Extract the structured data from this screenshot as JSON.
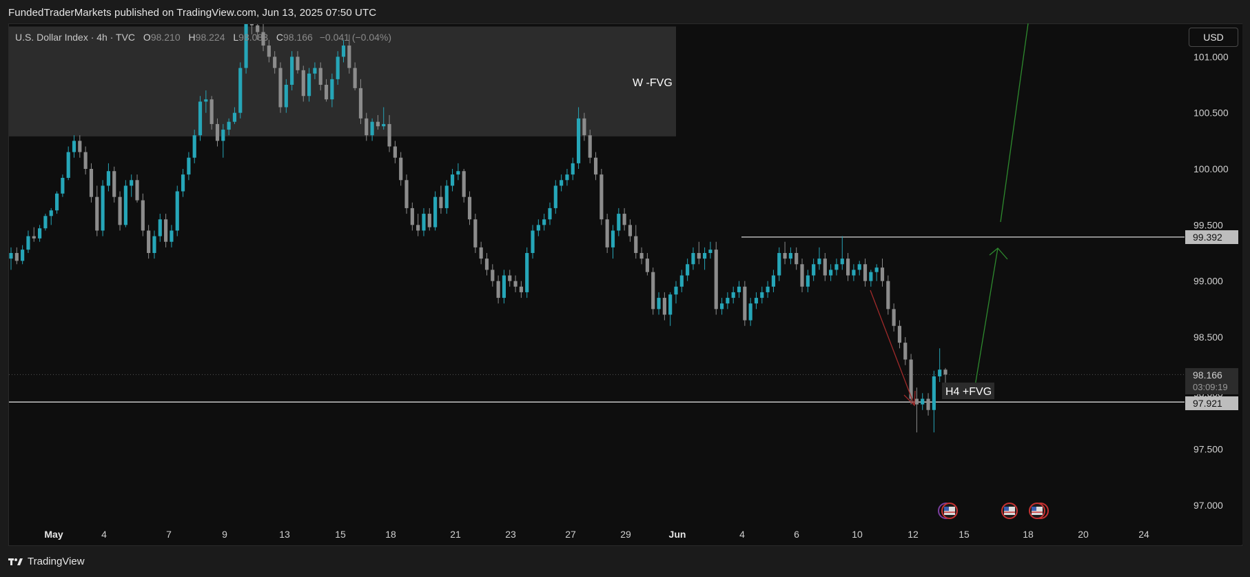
{
  "header": {
    "publisher": "FundedTraderMarkets published on TradingView.com, Jun 13, 2025 07:50 UTC"
  },
  "legend": {
    "symbol": "U.S. Dollar Index · 4h · TVC",
    "o_label": "O",
    "o_value": "98.210",
    "h_label": "H",
    "h_value": "98.224",
    "l_label": "L",
    "l_value": "98.083",
    "c_label": "C",
    "c_value": "98.166",
    "change": "−0.041 (−0.04%)"
  },
  "currency_button": "USD",
  "footer": {
    "brand": "TradingView"
  },
  "annotations": {
    "w_fvg": "W -FVG",
    "h4_fvg": "H4 +FVG"
  },
  "price_tags": {
    "resistance": "99.392",
    "last_price": "98.166",
    "countdown": "03:09:19",
    "support": "97.921"
  },
  "colors": {
    "up": "#26a6b8",
    "down": "#8c8c8c",
    "zone": "#2c2c2c",
    "arrow_up": "#2e8b2e",
    "arrow_down": "#a02a2a",
    "background": "#0e0e0e"
  },
  "chart_data": {
    "type": "candlestick",
    "yaxis": {
      "ticks": [
        "101.000",
        "100.500",
        "100.000",
        "99.500",
        "99.000",
        "98.500",
        "98.000",
        "97.500",
        "97.000"
      ],
      "range": [
        96.7,
        101.35
      ]
    },
    "xaxis": {
      "ticks": [
        "May",
        "4",
        "7",
        "9",
        "13",
        "15",
        "18",
        "21",
        "23",
        "27",
        "29",
        "Jun",
        "4",
        "6",
        "10",
        "12",
        "15",
        "18",
        "20",
        "24"
      ]
    },
    "zones": [
      {
        "label": "W -FVG",
        "from": 100.29,
        "to": 101.27
      }
    ],
    "levels": [
      {
        "value": 99.392,
        "label": "99.392"
      },
      {
        "value": 97.921,
        "label": "97.921"
      }
    ],
    "last": 98.166,
    "candles": [
      [
        99.2,
        99.3,
        99.1,
        99.25
      ],
      [
        99.25,
        99.3,
        99.15,
        99.18
      ],
      [
        99.18,
        99.32,
        99.15,
        99.28
      ],
      [
        99.28,
        99.45,
        99.25,
        99.4
      ],
      [
        99.4,
        99.48,
        99.35,
        99.38
      ],
      [
        99.38,
        99.5,
        99.35,
        99.47
      ],
      [
        99.47,
        99.6,
        99.45,
        99.58
      ],
      [
        99.58,
        99.65,
        99.5,
        99.63
      ],
      [
        99.63,
        99.8,
        99.6,
        99.78
      ],
      [
        99.78,
        99.95,
        99.75,
        99.92
      ],
      [
        99.92,
        100.2,
        99.9,
        100.15
      ],
      [
        100.15,
        100.3,
        100.1,
        100.25
      ],
      [
        100.25,
        100.3,
        100.1,
        100.15
      ],
      [
        100.15,
        100.2,
        99.95,
        100.0
      ],
      [
        100.0,
        100.05,
        99.7,
        99.75
      ],
      [
        99.75,
        99.85,
        99.4,
        99.45
      ],
      [
        99.45,
        99.9,
        99.4,
        99.85
      ],
      [
        99.85,
        100.05,
        99.8,
        99.98
      ],
      [
        99.98,
        100.02,
        99.7,
        99.75
      ],
      [
        99.75,
        99.8,
        99.45,
        99.5
      ],
      [
        99.5,
        99.9,
        99.48,
        99.85
      ],
      [
        99.85,
        99.95,
        99.75,
        99.9
      ],
      [
        99.9,
        99.95,
        99.7,
        99.72
      ],
      [
        99.72,
        99.78,
        99.4,
        99.45
      ],
      [
        99.45,
        99.5,
        99.2,
        99.25
      ],
      [
        99.25,
        99.45,
        99.2,
        99.4
      ],
      [
        99.4,
        99.6,
        99.35,
        99.55
      ],
      [
        99.55,
        99.6,
        99.3,
        99.35
      ],
      [
        99.35,
        99.5,
        99.3,
        99.45
      ],
      [
        99.45,
        99.85,
        99.4,
        99.8
      ],
      [
        99.8,
        100.0,
        99.75,
        99.95
      ],
      [
        99.95,
        100.15,
        99.9,
        100.1
      ],
      [
        100.1,
        100.35,
        100.05,
        100.3
      ],
      [
        100.3,
        100.65,
        100.25,
        100.6
      ],
      [
        100.6,
        100.7,
        100.5,
        100.62
      ],
      [
        100.62,
        100.65,
        100.35,
        100.4
      ],
      [
        100.4,
        100.45,
        100.2,
        100.25
      ],
      [
        100.25,
        100.4,
        100.1,
        100.35
      ],
      [
        100.35,
        100.45,
        100.3,
        100.42
      ],
      [
        100.42,
        100.55,
        100.4,
        100.5
      ],
      [
        100.5,
        100.95,
        100.45,
        100.9
      ],
      [
        100.9,
        101.4,
        100.85,
        101.3
      ],
      [
        101.3,
        101.35,
        101.2,
        101.28
      ],
      [
        101.28,
        101.32,
        101.15,
        101.22
      ],
      [
        101.22,
        101.3,
        101.05,
        101.1
      ],
      [
        101.1,
        101.15,
        100.95,
        101.0
      ],
      [
        101.0,
        101.05,
        100.85,
        100.9
      ],
      [
        100.9,
        100.95,
        100.5,
        100.55
      ],
      [
        100.55,
        100.8,
        100.5,
        100.75
      ],
      [
        100.75,
        101.05,
        100.7,
        101.0
      ],
      [
        101.0,
        101.05,
        100.85,
        100.88
      ],
      [
        100.88,
        100.92,
        100.6,
        100.65
      ],
      [
        100.65,
        100.9,
        100.6,
        100.85
      ],
      [
        100.85,
        100.95,
        100.8,
        100.9
      ],
      [
        100.9,
        100.95,
        100.7,
        100.75
      ],
      [
        100.75,
        100.8,
        100.6,
        100.62
      ],
      [
        100.62,
        100.85,
        100.55,
        100.8
      ],
      [
        100.8,
        101.05,
        100.75,
        101.0
      ],
      [
        101.0,
        101.15,
        100.95,
        101.1
      ],
      [
        101.1,
        101.2,
        100.85,
        100.9
      ],
      [
        100.9,
        100.95,
        100.7,
        100.72
      ],
      [
        100.72,
        100.8,
        100.4,
        100.45
      ],
      [
        100.45,
        100.5,
        100.25,
        100.3
      ],
      [
        100.3,
        100.45,
        100.25,
        100.42
      ],
      [
        100.42,
        100.48,
        100.35,
        100.38
      ],
      [
        100.38,
        100.55,
        100.35,
        100.4
      ],
      [
        100.4,
        100.48,
        100.15,
        100.2
      ],
      [
        100.2,
        100.25,
        100.05,
        100.1
      ],
      [
        100.1,
        100.15,
        99.85,
        99.9
      ],
      [
        99.9,
        99.95,
        99.6,
        99.65
      ],
      [
        99.65,
        99.7,
        99.45,
        99.5
      ],
      [
        99.5,
        99.6,
        99.4,
        99.45
      ],
      [
        99.45,
        99.65,
        99.4,
        99.6
      ],
      [
        99.6,
        99.65,
        99.45,
        99.48
      ],
      [
        99.48,
        99.8,
        99.45,
        99.75
      ],
      [
        99.75,
        99.85,
        99.6,
        99.65
      ],
      [
        99.65,
        99.9,
        99.6,
        99.85
      ],
      [
        99.85,
        100.0,
        99.8,
        99.95
      ],
      [
        99.95,
        100.05,
        99.9,
        99.98
      ],
      [
        99.98,
        100.0,
        99.7,
        99.75
      ],
      [
        99.75,
        99.8,
        99.5,
        99.55
      ],
      [
        99.55,
        99.6,
        99.25,
        99.3
      ],
      [
        99.3,
        99.35,
        99.15,
        99.2
      ],
      [
        99.2,
        99.25,
        99.05,
        99.1
      ],
      [
        99.1,
        99.15,
        98.95,
        99.0
      ],
      [
        99.0,
        99.05,
        98.8,
        98.85
      ],
      [
        98.85,
        99.1,
        98.8,
        99.05
      ],
      [
        99.05,
        99.1,
        98.95,
        99.0
      ],
      [
        99.0,
        99.05,
        98.9,
        98.95
      ],
      [
        98.95,
        99.0,
        98.85,
        98.9
      ],
      [
        98.9,
        99.3,
        98.85,
        99.25
      ],
      [
        99.25,
        99.5,
        99.2,
        99.45
      ],
      [
        99.45,
        99.55,
        99.4,
        99.5
      ],
      [
        99.5,
        99.6,
        99.45,
        99.55
      ],
      [
        99.55,
        99.7,
        99.5,
        99.65
      ],
      [
        99.65,
        99.9,
        99.6,
        99.85
      ],
      [
        99.85,
        99.95,
        99.8,
        99.9
      ],
      [
        99.9,
        100.0,
        99.85,
        99.95
      ],
      [
        99.95,
        100.1,
        99.9,
        100.05
      ],
      [
        100.05,
        100.55,
        100.0,
        100.45
      ],
      [
        100.45,
        100.5,
        100.25,
        100.3
      ],
      [
        100.3,
        100.35,
        100.05,
        100.1
      ],
      [
        100.1,
        100.15,
        99.9,
        99.95
      ],
      [
        99.95,
        100.0,
        99.5,
        99.55
      ],
      [
        99.55,
        99.6,
        99.25,
        99.3
      ],
      [
        99.3,
        99.5,
        99.2,
        99.45
      ],
      [
        99.45,
        99.65,
        99.4,
        99.6
      ],
      [
        99.6,
        99.65,
        99.45,
        99.5
      ],
      [
        99.5,
        99.55,
        99.35,
        99.4
      ],
      [
        99.4,
        99.5,
        99.2,
        99.25
      ],
      [
        99.25,
        99.3,
        99.15,
        99.2
      ],
      [
        99.2,
        99.25,
        99.05,
        99.08
      ],
      [
        99.08,
        99.12,
        98.7,
        98.75
      ],
      [
        98.75,
        98.9,
        98.7,
        98.85
      ],
      [
        98.85,
        98.9,
        98.65,
        98.7
      ],
      [
        98.7,
        98.9,
        98.6,
        98.88
      ],
      [
        98.88,
        99.0,
        98.8,
        98.95
      ],
      [
        98.95,
        99.1,
        98.9,
        99.05
      ],
      [
        99.05,
        99.2,
        99.0,
        99.15
      ],
      [
        99.15,
        99.3,
        99.1,
        99.25
      ],
      [
        99.25,
        99.35,
        99.15,
        99.2
      ],
      [
        99.2,
        99.3,
        99.1,
        99.25
      ],
      [
        99.25,
        99.35,
        99.2,
        99.28
      ],
      [
        99.28,
        99.35,
        98.7,
        98.75
      ],
      [
        98.75,
        98.85,
        98.7,
        98.8
      ],
      [
        98.8,
        98.9,
        98.75,
        98.85
      ],
      [
        98.85,
        98.95,
        98.8,
        98.9
      ],
      [
        98.9,
        99.0,
        98.85,
        98.95
      ],
      [
        98.95,
        99.0,
        98.6,
        98.65
      ],
      [
        98.65,
        98.85,
        98.6,
        98.8
      ],
      [
        98.8,
        98.9,
        98.75,
        98.85
      ],
      [
        98.85,
        98.95,
        98.8,
        98.9
      ],
      [
        98.9,
        99.0,
        98.85,
        98.95
      ],
      [
        98.95,
        99.1,
        98.9,
        99.05
      ],
      [
        99.05,
        99.3,
        99.0,
        99.25
      ],
      [
        99.25,
        99.35,
        99.15,
        99.2
      ],
      [
        99.2,
        99.3,
        99.15,
        99.25
      ],
      [
        99.25,
        99.3,
        99.1,
        99.15
      ],
      [
        99.15,
        99.2,
        98.9,
        98.95
      ],
      [
        98.95,
        99.1,
        98.9,
        99.05
      ],
      [
        99.05,
        99.2,
        99.0,
        99.15
      ],
      [
        99.15,
        99.3,
        99.1,
        99.2
      ],
      [
        99.2,
        99.25,
        99.0,
        99.05
      ],
      [
        99.05,
        99.15,
        99.0,
        99.1
      ],
      [
        99.1,
        99.2,
        99.05,
        99.15
      ],
      [
        99.15,
        99.4,
        99.1,
        99.2
      ],
      [
        99.2,
        99.25,
        99.0,
        99.05
      ],
      [
        99.05,
        99.15,
        99.0,
        99.1
      ],
      [
        99.1,
        99.18,
        99.05,
        99.15
      ],
      [
        99.15,
        99.2,
        98.95,
        99.0
      ],
      [
        99.0,
        99.1,
        98.95,
        99.08
      ],
      [
        99.08,
        99.15,
        99.0,
        99.12
      ],
      [
        99.12,
        99.2,
        98.95,
        99.0
      ],
      [
        99.0,
        99.05,
        98.7,
        98.75
      ],
      [
        98.75,
        98.8,
        98.55,
        98.6
      ],
      [
        98.6,
        98.65,
        98.4,
        98.45
      ],
      [
        98.45,
        98.5,
        98.25,
        98.3
      ],
      [
        98.3,
        98.35,
        97.9,
        97.95
      ],
      [
        97.95,
        98.05,
        97.65,
        97.9
      ],
      [
        97.9,
        98.0,
        97.85,
        97.95
      ],
      [
        97.95,
        98.0,
        97.8,
        97.85
      ],
      [
        97.85,
        98.2,
        97.65,
        98.15
      ],
      [
        98.15,
        98.4,
        98.1,
        98.21
      ],
      [
        98.21,
        98.224,
        98.083,
        98.166
      ]
    ]
  }
}
